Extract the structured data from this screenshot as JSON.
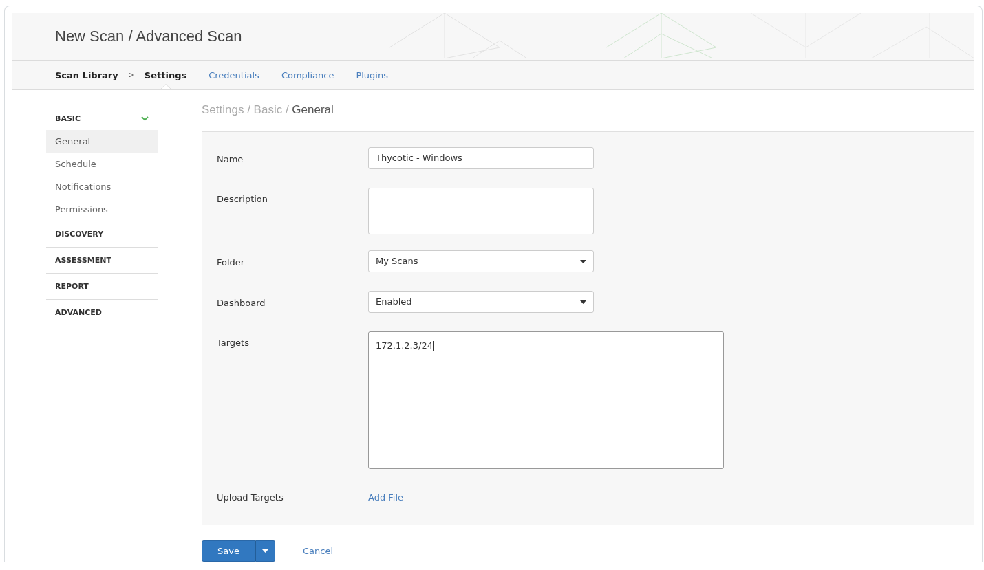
{
  "header": {
    "title": "New Scan / Advanced Scan"
  },
  "nav": {
    "breadcrumb": "Scan Library",
    "separator": ">",
    "tabs": [
      {
        "label": "Settings",
        "selected": true
      },
      {
        "label": "Credentials",
        "selected": false
      },
      {
        "label": "Compliance",
        "selected": false
      },
      {
        "label": "Plugins",
        "selected": false
      }
    ]
  },
  "sidebar": {
    "sections": [
      {
        "label": "BASIC",
        "expanded": true,
        "items": [
          {
            "label": "General",
            "selected": true
          },
          {
            "label": "Schedule",
            "selected": false
          },
          {
            "label": "Notifications",
            "selected": false
          },
          {
            "label": "Permissions",
            "selected": false
          }
        ]
      },
      {
        "label": "DISCOVERY",
        "expanded": false
      },
      {
        "label": "ASSESSMENT",
        "expanded": false
      },
      {
        "label": "REPORT",
        "expanded": false
      },
      {
        "label": "ADVANCED",
        "expanded": false
      }
    ]
  },
  "content": {
    "breadcrumb": {
      "path": "Settings / Basic /",
      "current": "General"
    },
    "fields": [
      {
        "kind": "text",
        "label": "Name",
        "value": "Thycotic - Windows"
      },
      {
        "kind": "textarea",
        "label": "Description"
      },
      {
        "kind": "select",
        "label": "Folder",
        "value": "My Scans"
      },
      {
        "kind": "select",
        "label": "Dashboard",
        "value": "Enabled"
      },
      {
        "kind": "targets",
        "label": "Targets",
        "value": "172.1.2.3/24"
      },
      {
        "kind": "link",
        "label": "Upload Targets",
        "value": "Add File"
      }
    ]
  },
  "actions": {
    "save": "Save",
    "cancel": "Cancel"
  }
}
